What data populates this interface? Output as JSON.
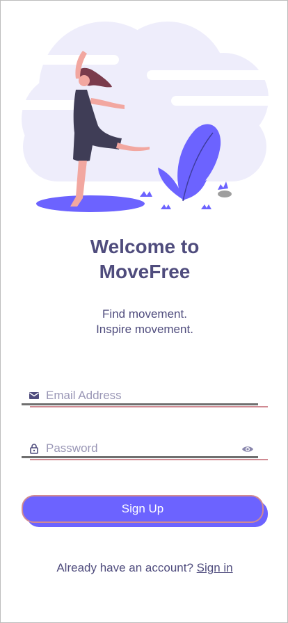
{
  "hero": {
    "illustration_icon": "dancing-woman-illustration",
    "accent_color": "#6c63ff",
    "cloud_color": "#eeedfb"
  },
  "welcome": {
    "title_line1": "Welcome to",
    "title_line2": "MoveFree"
  },
  "tagline": {
    "line1": "Find movement.",
    "line2": "Inspire movement."
  },
  "email_field": {
    "icon": "mail-icon",
    "placeholder": "Email Address",
    "value": ""
  },
  "password_field": {
    "icon": "lock-icon",
    "placeholder": "Password",
    "value": "",
    "toggle_icon": "eye-icon"
  },
  "signup_button": {
    "label": "Sign Up",
    "color": "#6c63ff"
  },
  "signin_prompt": {
    "text": "Already have an account?",
    "link_label": "Sign in"
  },
  "colors": {
    "text_primary": "#4f4c7d",
    "placeholder": "#9a97b6",
    "underline_pink": "#d08a92",
    "underline_dark": "#6f6f6f"
  }
}
